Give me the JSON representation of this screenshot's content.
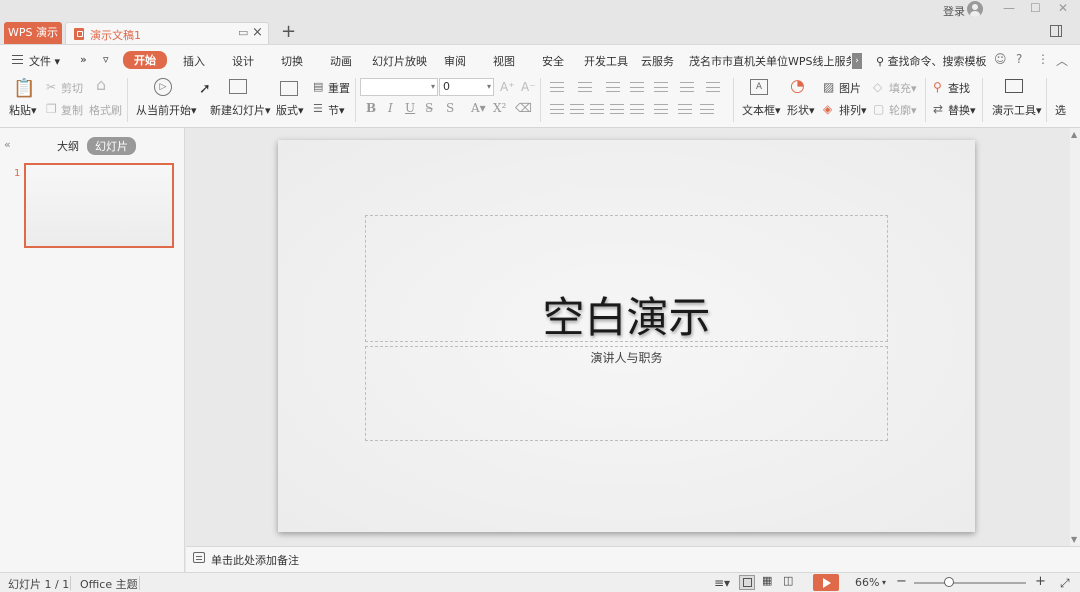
{
  "titlebar": {
    "app_tab": "WPS 演示",
    "doc_title": "演示文稿1",
    "new_tab": "+",
    "login": "登录",
    "window_buttons": [
      "—",
      "☐",
      "✕"
    ]
  },
  "menu": {
    "file": "文件",
    "more": "»",
    "dropdown": "▿",
    "tabs": [
      "开始",
      "插入",
      "设计",
      "切换",
      "动画",
      "幻灯片放映",
      "审阅",
      "视图",
      "安全",
      "开发工具",
      "云服务",
      "茂名市市直机关单位WPS线上服务通道"
    ],
    "active_tab": "开始",
    "search": "查找命令、搜索模板",
    "icons": [
      "☺",
      "?",
      "⋮",
      "︿"
    ]
  },
  "toolbar": {
    "paste": "粘贴",
    "cut": "剪切",
    "copy": "复制",
    "format_painter": "格式刷",
    "play_from_current": "从当前开始",
    "new_slide": "新建幻灯片",
    "layout": "版式",
    "reset": "重置",
    "section": "节",
    "font_name": "",
    "font_size": "0",
    "text_box": "文本框",
    "shape": "形状",
    "picture": "图片",
    "arrange": "排列",
    "fill": "填充",
    "outline": "轮廓",
    "find": "查找",
    "replace": "替换",
    "presentation_tools": "演示工具",
    "select": "选"
  },
  "left_panel": {
    "outline_tab": "大纲",
    "slides_tab": "幻灯片",
    "slide_number": "1"
  },
  "slide": {
    "title": "空白演示",
    "subtitle": "演讲人与职务"
  },
  "notes": {
    "placeholder": "单击此处添加备注"
  },
  "status": {
    "slide_indicator": "幻灯片 1 / 1",
    "theme": "Office 主题",
    "zoom": "66%",
    "zoom_level": 0.66,
    "zoom_out": "−",
    "zoom_in": "+"
  },
  "colors": {
    "accent": "#e0694a"
  }
}
